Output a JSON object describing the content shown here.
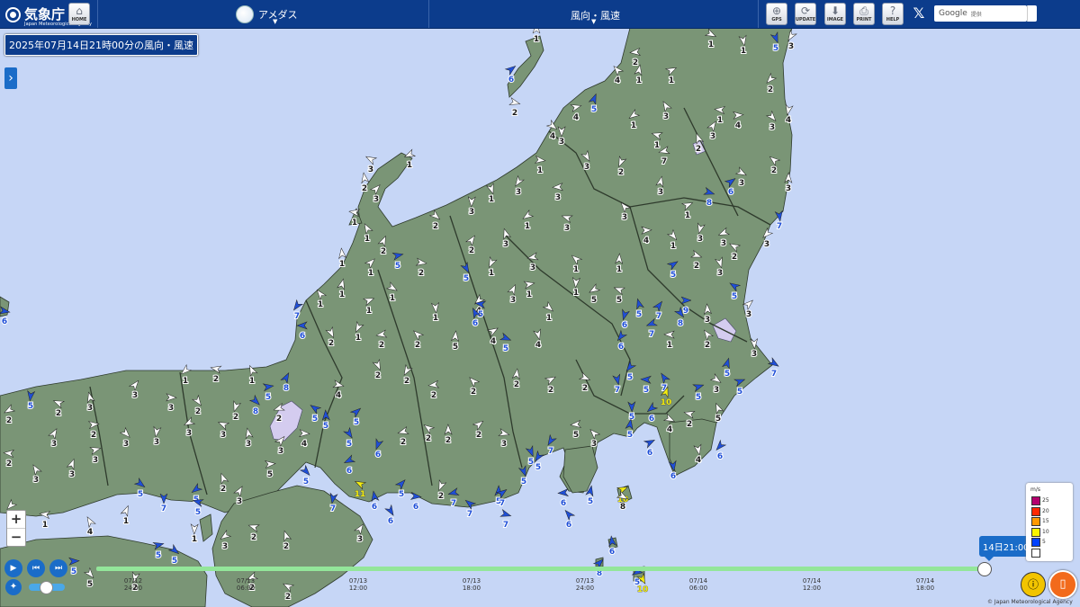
{
  "header": {
    "logo_name": "気象庁",
    "logo_sub": "Japan Meteorological Agency",
    "home_label": "HOME",
    "element_label": "アメダス",
    "param_label": "風向・風速",
    "buttons": [
      {
        "label": "GPS",
        "icon": "gps-icon"
      },
      {
        "label": "UPDATE",
        "icon": "update-icon"
      },
      {
        "label": "IMAGE",
        "icon": "download-icon"
      },
      {
        "label": "PRINT",
        "icon": "print-icon"
      },
      {
        "label": "HELP",
        "icon": "help-icon"
      }
    ],
    "search_brand": "Google",
    "search_provided": "提供"
  },
  "time_title": "2025年07月14日21時00分の風向・風速",
  "timeline": {
    "current": "14日21:00",
    "ticks": [
      {
        "date": "07/12",
        "time": "24:00"
      },
      {
        "date": "07/13",
        "time": "06:00"
      },
      {
        "date": "07/13",
        "time": "12:00"
      },
      {
        "date": "07/13",
        "time": "18:00"
      },
      {
        "date": "07/13",
        "time": "24:00"
      },
      {
        "date": "07/14",
        "time": "06:00"
      },
      {
        "date": "07/14",
        "time": "12:00"
      },
      {
        "date": "07/14",
        "time": "18:00"
      }
    ]
  },
  "legend": {
    "unit": "m/s",
    "items": [
      {
        "label": "25",
        "color": "#b4006e"
      },
      {
        "label": "20",
        "color": "#ff2800"
      },
      {
        "label": "15",
        "color": "#ff9900"
      },
      {
        "label": "10",
        "color": "#faf500"
      },
      {
        "label": "5",
        "color": "#0041ff"
      },
      {
        "label": "",
        "color": "#ffffff"
      }
    ]
  },
  "colors": {
    "land": "#7a9576",
    "sea": "#c6d6f6",
    "lake": "#d4ccef",
    "header": "#0c3c8c"
  },
  "zoom": {
    "in": "+",
    "out": "−"
  },
  "copyright": "© Japan Meteorological Agency",
  "stations": [
    [
      596,
      40,
      "1",
      "w"
    ],
    [
      568,
      85,
      "6",
      "b"
    ],
    [
      572,
      122,
      "2",
      "w"
    ],
    [
      862,
      50,
      "5",
      "b"
    ],
    [
      879,
      48,
      "3",
      "w"
    ],
    [
      706,
      66,
      "2",
      "w"
    ],
    [
      686,
      86,
      "4",
      "w"
    ],
    [
      710,
      86,
      "1",
      "w"
    ],
    [
      746,
      86,
      "1",
      "w"
    ],
    [
      790,
      46,
      "1",
      "w"
    ],
    [
      826,
      53,
      "1",
      "w"
    ],
    [
      856,
      96,
      "2",
      "w"
    ],
    [
      800,
      130,
      "1",
      "w"
    ],
    [
      740,
      126,
      "3",
      "w"
    ],
    [
      660,
      118,
      "5",
      "b"
    ],
    [
      640,
      127,
      "4",
      "w"
    ],
    [
      614,
      148,
      "4",
      "w"
    ],
    [
      624,
      154,
      "3",
      "w"
    ],
    [
      704,
      136,
      "1",
      "w"
    ],
    [
      730,
      158,
      "1",
      "w"
    ],
    [
      776,
      162,
      "2",
      "w"
    ],
    [
      792,
      148,
      "3",
      "w"
    ],
    [
      820,
      136,
      "4",
      "w"
    ],
    [
      858,
      138,
      "3",
      "w"
    ],
    [
      876,
      130,
      "4",
      "w"
    ],
    [
      455,
      180,
      "1",
      "w"
    ],
    [
      412,
      185,
      "3",
      "w"
    ],
    [
      405,
      206,
      "2",
      "w"
    ],
    [
      418,
      218,
      "3",
      "w"
    ],
    [
      600,
      186,
      "1",
      "w"
    ],
    [
      652,
      182,
      "3",
      "w"
    ],
    [
      690,
      188,
      "2",
      "w"
    ],
    [
      738,
      176,
      "7",
      "w"
    ],
    [
      860,
      186,
      "2",
      "w"
    ],
    [
      876,
      206,
      "3",
      "w"
    ],
    [
      812,
      210,
      "6",
      "b"
    ],
    [
      788,
      222,
      "8",
      "b"
    ],
    [
      546,
      218,
      "1",
      "w"
    ],
    [
      576,
      210,
      "3",
      "w"
    ],
    [
      620,
      216,
      "3",
      "w"
    ],
    [
      694,
      238,
      "3",
      "w"
    ],
    [
      734,
      210,
      "3",
      "w"
    ],
    [
      764,
      236,
      "1",
      "w"
    ],
    [
      824,
      200,
      "3",
      "w"
    ],
    [
      866,
      248,
      "7",
      "b"
    ],
    [
      852,
      268,
      "3",
      "w"
    ],
    [
      394,
      244,
      "1",
      "w"
    ],
    [
      408,
      262,
      "1",
      "w"
    ],
    [
      426,
      276,
      "2",
      "w"
    ],
    [
      442,
      292,
      "5",
      "b"
    ],
    [
      484,
      248,
      "2",
      "w"
    ],
    [
      524,
      232,
      "3",
      "w"
    ],
    [
      586,
      248,
      "1",
      "w"
    ],
    [
      630,
      250,
      "3",
      "w"
    ],
    [
      562,
      268,
      "3",
      "w"
    ],
    [
      524,
      275,
      "2",
      "w"
    ],
    [
      718,
      264,
      "4",
      "w"
    ],
    [
      748,
      270,
      "1",
      "w"
    ],
    [
      778,
      262,
      "3",
      "w"
    ],
    [
      804,
      267,
      "3",
      "w"
    ],
    [
      816,
      282,
      "2",
      "w"
    ],
    [
      380,
      290,
      "1",
      "w"
    ],
    [
      412,
      300,
      "1",
      "w"
    ],
    [
      468,
      300,
      "2",
      "w"
    ],
    [
      518,
      306,
      "5",
      "b"
    ],
    [
      546,
      300,
      "1",
      "w"
    ],
    [
      592,
      294,
      "3",
      "w"
    ],
    [
      640,
      296,
      "1",
      "w"
    ],
    [
      688,
      296,
      "1",
      "w"
    ],
    [
      748,
      302,
      "5",
      "b"
    ],
    [
      774,
      292,
      "2",
      "w"
    ],
    [
      800,
      300,
      "3",
      "w"
    ],
    [
      330,
      348,
      "7",
      "b"
    ],
    [
      336,
      370,
      "6",
      "b"
    ],
    [
      356,
      335,
      "1",
      "w"
    ],
    [
      380,
      324,
      "1",
      "w"
    ],
    [
      410,
      342,
      "1",
      "w"
    ],
    [
      436,
      328,
      "1",
      "w"
    ],
    [
      484,
      350,
      "1",
      "w"
    ],
    [
      532,
      342,
      "4",
      "w"
    ],
    [
      534,
      346,
      "5",
      "b"
    ],
    [
      528,
      356,
      "6",
      "b"
    ],
    [
      570,
      330,
      "3",
      "w"
    ],
    [
      588,
      324,
      "1",
      "w"
    ],
    [
      610,
      350,
      "1",
      "w"
    ],
    [
      640,
      322,
      "1",
      "w"
    ],
    [
      660,
      330,
      "5",
      "w"
    ],
    [
      688,
      330,
      "5",
      "w"
    ],
    [
      710,
      346,
      "5",
      "b"
    ],
    [
      732,
      348,
      "7",
      "b"
    ],
    [
      762,
      342,
      "9",
      "b"
    ],
    [
      756,
      356,
      "8",
      "b"
    ],
    [
      694,
      358,
      "6",
      "b"
    ],
    [
      724,
      368,
      "7",
      "b"
    ],
    [
      816,
      326,
      "5",
      "b"
    ],
    [
      786,
      352,
      "3",
      "w"
    ],
    [
      832,
      346,
      "3",
      "w"
    ],
    [
      5,
      354,
      "6",
      "b"
    ],
    [
      368,
      378,
      "2",
      "w"
    ],
    [
      398,
      372,
      "1",
      "w"
    ],
    [
      424,
      380,
      "2",
      "w"
    ],
    [
      464,
      380,
      "2",
      "w"
    ],
    [
      506,
      382,
      "5",
      "w"
    ],
    [
      548,
      376,
      "4",
      "w"
    ],
    [
      562,
      384,
      "5",
      "b"
    ],
    [
      598,
      380,
      "4",
      "w"
    ],
    [
      690,
      382,
      "6",
      "b"
    ],
    [
      744,
      380,
      "1",
      "w"
    ],
    [
      786,
      380,
      "2",
      "w"
    ],
    [
      808,
      412,
      "5",
      "b"
    ],
    [
      822,
      432,
      "5",
      "b"
    ],
    [
      860,
      412,
      "7",
      "b"
    ],
    [
      838,
      390,
      "3",
      "w"
    ],
    [
      206,
      420,
      "1",
      "w"
    ],
    [
      240,
      418,
      "2",
      "w"
    ],
    [
      280,
      420,
      "1",
      "w"
    ],
    [
      318,
      428,
      "8",
      "b"
    ],
    [
      298,
      438,
      "5",
      "b"
    ],
    [
      284,
      454,
      "8",
      "b"
    ],
    [
      34,
      448,
      "5",
      "b"
    ],
    [
      10,
      464,
      "2",
      "w"
    ],
    [
      65,
      456,
      "2",
      "w"
    ],
    [
      100,
      450,
      "3",
      "w"
    ],
    [
      150,
      436,
      "3",
      "w"
    ],
    [
      190,
      450,
      "3",
      "w"
    ],
    [
      220,
      454,
      "2",
      "w"
    ],
    [
      262,
      460,
      "2",
      "w"
    ],
    [
      310,
      462,
      "2",
      "w"
    ],
    [
      350,
      462,
      "5",
      "b"
    ],
    [
      362,
      470,
      "5",
      "b"
    ],
    [
      396,
      466,
      "5",
      "b"
    ],
    [
      376,
      436,
      "4",
      "w"
    ],
    [
      420,
      414,
      "2",
      "w"
    ],
    [
      452,
      420,
      "2",
      "w"
    ],
    [
      482,
      436,
      "2",
      "w"
    ],
    [
      526,
      432,
      "2",
      "w"
    ],
    [
      574,
      424,
      "2",
      "w"
    ],
    [
      612,
      430,
      "2",
      "w"
    ],
    [
      650,
      428,
      "2",
      "w"
    ],
    [
      686,
      430,
      "7",
      "b"
    ],
    [
      700,
      416,
      "5",
      "b"
    ],
    [
      718,
      430,
      "5",
      "b"
    ],
    [
      738,
      428,
      "7",
      "b"
    ],
    [
      740,
      444,
      "10",
      "y"
    ],
    [
      776,
      438,
      "5",
      "b"
    ],
    [
      796,
      430,
      "3",
      "w"
    ],
    [
      702,
      460,
      "5",
      "b"
    ],
    [
      724,
      462,
      "6",
      "b"
    ],
    [
      766,
      468,
      "2",
      "w"
    ],
    [
      798,
      462,
      "5",
      "w"
    ],
    [
      60,
      490,
      "3",
      "w"
    ],
    [
      104,
      480,
      "2",
      "w"
    ],
    [
      140,
      490,
      "3",
      "w"
    ],
    [
      174,
      488,
      "3",
      "w"
    ],
    [
      210,
      478,
      "3",
      "w"
    ],
    [
      248,
      480,
      "3",
      "w"
    ],
    [
      276,
      490,
      "3",
      "w"
    ],
    [
      312,
      498,
      "3",
      "w"
    ],
    [
      338,
      490,
      "4",
      "w"
    ],
    [
      388,
      490,
      "5",
      "b"
    ],
    [
      420,
      502,
      "6",
      "b"
    ],
    [
      448,
      488,
      "2",
      "w"
    ],
    [
      476,
      484,
      "2",
      "w"
    ],
    [
      498,
      486,
      "2",
      "w"
    ],
    [
      532,
      480,
      "2",
      "w"
    ],
    [
      560,
      490,
      "3",
      "w"
    ],
    [
      590,
      510,
      "5",
      "b"
    ],
    [
      612,
      498,
      "7",
      "b"
    ],
    [
      640,
      480,
      "5",
      "w"
    ],
    [
      660,
      490,
      "3",
      "w"
    ],
    [
      700,
      480,
      "5",
      "b"
    ],
    [
      722,
      500,
      "6",
      "b"
    ],
    [
      744,
      474,
      "4",
      "w"
    ],
    [
      776,
      508,
      "4",
      "w"
    ],
    [
      800,
      504,
      "6",
      "b"
    ],
    [
      10,
      512,
      "2",
      "w"
    ],
    [
      40,
      530,
      "3",
      "w"
    ],
    [
      80,
      524,
      "3",
      "w"
    ],
    [
      106,
      508,
      "3",
      "w"
    ],
    [
      156,
      546,
      "5",
      "b"
    ],
    [
      182,
      562,
      "7",
      "b"
    ],
    [
      218,
      552,
      "5",
      "b"
    ],
    [
      220,
      566,
      "5",
      "b"
    ],
    [
      248,
      540,
      "2",
      "w"
    ],
    [
      266,
      554,
      "3",
      "w"
    ],
    [
      300,
      524,
      "5",
      "w"
    ],
    [
      340,
      532,
      "5",
      "b"
    ],
    [
      370,
      562,
      "7",
      "b"
    ],
    [
      388,
      520,
      "6",
      "b"
    ],
    [
      400,
      546,
      "11",
      "y"
    ],
    [
      416,
      560,
      "6",
      "b"
    ],
    [
      446,
      546,
      "5",
      "b"
    ],
    [
      462,
      560,
      "6",
      "b"
    ],
    [
      434,
      576,
      "6",
      "b"
    ],
    [
      490,
      548,
      "2",
      "w"
    ],
    [
      504,
      556,
      "7",
      "b"
    ],
    [
      522,
      568,
      "7",
      "b"
    ],
    [
      554,
      554,
      "5",
      "b"
    ],
    [
      558,
      556,
      "7",
      "b"
    ],
    [
      562,
      580,
      "7",
      "b"
    ],
    [
      582,
      532,
      "5",
      "b"
    ],
    [
      598,
      516,
      "5",
      "b"
    ],
    [
      626,
      556,
      "6",
      "b"
    ],
    [
      632,
      580,
      "6",
      "b"
    ],
    [
      656,
      554,
      "5",
      "b"
    ],
    [
      692,
      552,
      "10",
      "y"
    ],
    [
      692,
      560,
      "8",
      "w"
    ],
    [
      748,
      526,
      "6",
      "b"
    ],
    [
      12,
      570,
      "3",
      "w"
    ],
    [
      50,
      580,
      "1",
      "w"
    ],
    [
      100,
      588,
      "4",
      "w"
    ],
    [
      140,
      576,
      "1",
      "w"
    ],
    [
      176,
      614,
      "5",
      "b"
    ],
    [
      194,
      620,
      "5",
      "b"
    ],
    [
      216,
      596,
      "1",
      "w"
    ],
    [
      250,
      604,
      "3",
      "w"
    ],
    [
      282,
      594,
      "2",
      "w"
    ],
    [
      318,
      604,
      "2",
      "w"
    ],
    [
      400,
      596,
      "3",
      "w"
    ],
    [
      82,
      632,
      "5",
      "b"
    ],
    [
      100,
      646,
      "5",
      "w"
    ],
    [
      150,
      650,
      "2",
      "w"
    ],
    [
      280,
      650,
      "2",
      "w"
    ],
    [
      320,
      660,
      "2",
      "w"
    ],
    [
      680,
      610,
      "6",
      "b"
    ],
    [
      666,
      634,
      "8",
      "b"
    ],
    [
      708,
      644,
      "5",
      "b"
    ],
    [
      714,
      652,
      "10",
      "y"
    ]
  ]
}
